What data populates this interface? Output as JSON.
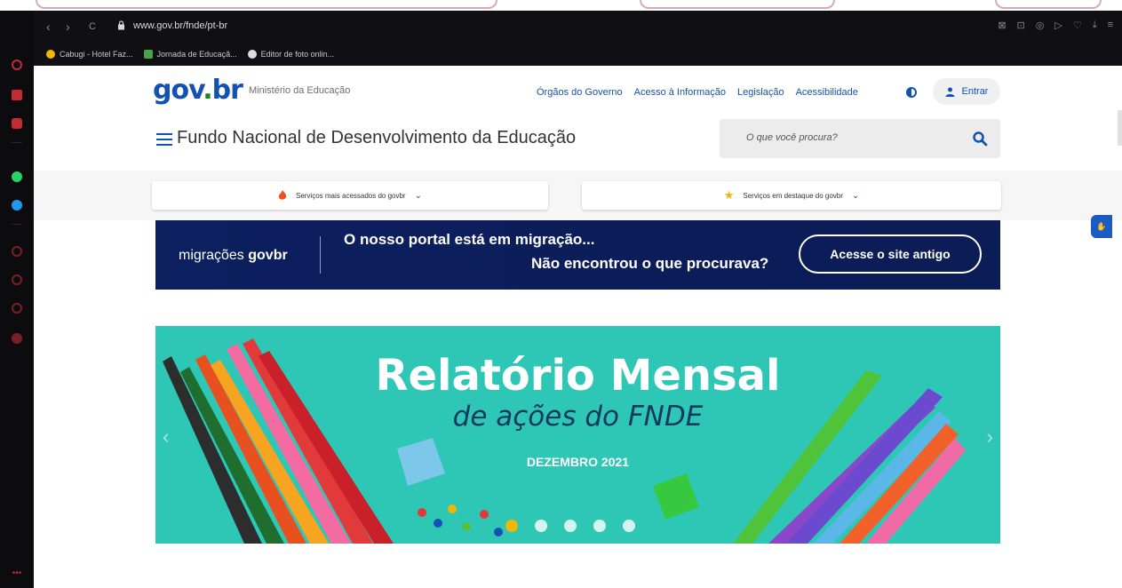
{
  "browser": {
    "url": "www.gov.br/fnde/pt-br",
    "nav_back": "‹",
    "nav_forward": "›",
    "nav_reload": "C",
    "bookmarks": [
      {
        "label": "Cabugi - Hotel Faz...",
        "color": "#f2b705"
      },
      {
        "label": "Jornada de Educaçã...",
        "color": "#4aa14b"
      },
      {
        "label": "Editor de foto onlin...",
        "color": "#dddddd"
      }
    ],
    "toolbar_icons": [
      "⊠",
      "⊡",
      "◎",
      "▷",
      "♡",
      "⤓",
      "≡"
    ],
    "sidebar_colors": [
      "#c42b35",
      "#c42b35",
      "#c42b35",
      "#25d366",
      "#1d9bf0",
      "#7a1f27",
      "#7a1f27",
      "#7a1f27",
      "#7a1f27"
    ]
  },
  "header": {
    "logo_gov": "gov",
    "logo_dot": ".",
    "logo_br": "br",
    "ministry": "Ministério da Educação",
    "links": [
      "Órgãos do Governo",
      "Acesso à Informação",
      "Legislação",
      "Acessibilidade"
    ],
    "login_label": "Entrar",
    "site_title": "Fundo Nacional de Desenvolvimento da Educação",
    "search_placeholder": "O que você procura?"
  },
  "services": {
    "most_accessed": "Serviços mais acessados do govbr",
    "featured": "Serviços em destaque do govbr"
  },
  "migration_banner": {
    "label_prefix": "migrações ",
    "label_brand": "govbr",
    "line1": "O nosso portal está em migração...",
    "line2": "Não encontrou o que procurava?",
    "button": "Acesse o site antigo"
  },
  "hero": {
    "title": "Relatório Mensal",
    "subtitle": "de ações do FNDE",
    "date": "DEZEMBRO 2021",
    "slides": 5,
    "active_slide": 1
  },
  "colors": {
    "brand_blue": "#1351b4",
    "banner_navy": "#0c1f5e",
    "hero_teal": "#2ec7b6"
  }
}
